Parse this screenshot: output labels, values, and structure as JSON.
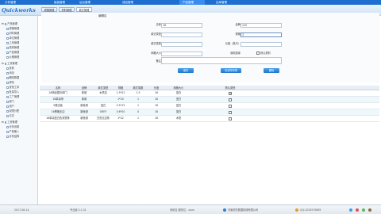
{
  "top_nav": {
    "tabs": [
      {
        "label": "计件管理"
      },
      {
        "label": "组装管理"
      },
      {
        "label": "后台管理"
      },
      {
        "label": "成品管理"
      },
      {
        "label": "产品管理"
      },
      {
        "label": "出库管理"
      }
    ]
  },
  "logo": {
    "text": "Quickworks"
  },
  "sidebar": {
    "items": [
      {
        "label": "产品管理"
      },
      {
        "label": "规格管理"
      },
      {
        "label": "材料管理"
      },
      {
        "label": "单位管理"
      },
      {
        "label": "工序管理"
      },
      {
        "label": "类别管理"
      },
      {
        "label": "产品管理"
      },
      {
        "label": "价格管理"
      },
      {
        "label": "工资管理"
      },
      {
        "label": "查看"
      },
      {
        "label": "添加"
      },
      {
        "label": "删除数据"
      },
      {
        "label": "修改"
      },
      {
        "label": "查找工序"
      },
      {
        "label": "批量导入"
      },
      {
        "label": "工厂管理"
      },
      {
        "label": "部门"
      },
      {
        "label": "用户"
      },
      {
        "label": "权限分配"
      },
      {
        "label": "日志"
      },
      {
        "label": "工资管理"
      },
      {
        "label": "月份设置"
      },
      {
        "label": "产量输入"
      },
      {
        "label": "月份结算"
      }
    ]
  },
  "sub_tabs": [
    {
      "label": "规格管理"
    },
    {
      "label": "材料管理"
    },
    {
      "label": "款式管理"
    }
  ],
  "form": {
    "title": "编辑区",
    "fields": [
      {
        "label": "名称",
        "value": "16"
      },
      {
        "label": "品牌",
        "value": "125"
      },
      {
        "label": "款式类型",
        "value": ""
      },
      {
        "label": "规格",
        "value": "3"
      },
      {
        "label": "款式类型",
        "value": ""
      },
      {
        "label": "长度（英尺）",
        "value": ""
      },
      {
        "label": "网格大小",
        "value": ""
      },
      {
        "label": "使用选择",
        "value": ""
      },
      {
        "label": "备注",
        "value": ""
      }
    ],
    "checkbox_label": "默认类别",
    "buttons": {
      "save": "保存",
      "reset": "清空所有项",
      "delete": "删除"
    }
  },
  "table": {
    "headers": [
      "名称",
      "品牌",
      "款式类型",
      "规格",
      "款式周数",
      "长度",
      "网格大小",
      "默认类别"
    ],
    "rows": [
      {
        "cells": [
          "16喷涂银光球门",
          "新城",
          "木质边",
          "1.5*22",
          "1.5",
          "16",
          "蓝白"
        ],
        "checked": true
      },
      {
        "cells": [
          "16单涂喷",
          "新城",
          "",
          "1*20",
          "1",
          "16",
          "蓝白"
        ],
        "checked": false
      },
      {
        "cells": [
          "5角边板",
          "新渔港",
          "蓝白",
          "0.5*15",
          "1",
          "16",
          "蓝白"
        ],
        "checked": false
      },
      {
        "cells": [
          "16黑格无边",
          "新渔港",
          "GREY",
          "0.6*20",
          "0",
          "16",
          "蓝白"
        ],
        "checked": false
      },
      {
        "cells": [
          "16单涂蓝白色双镜条",
          "新渔港",
          "白色无边条",
          "1*22",
          "1",
          "16",
          "木质"
        ],
        "checked": false
      }
    ]
  },
  "footer": {
    "date": "2017-08-14",
    "version": "专业版 2.1.31",
    "status": "系统名 服务位 - xxxx",
    "company": "济南恒先数据机械有限公司",
    "qq": "QQ:1234575665"
  }
}
